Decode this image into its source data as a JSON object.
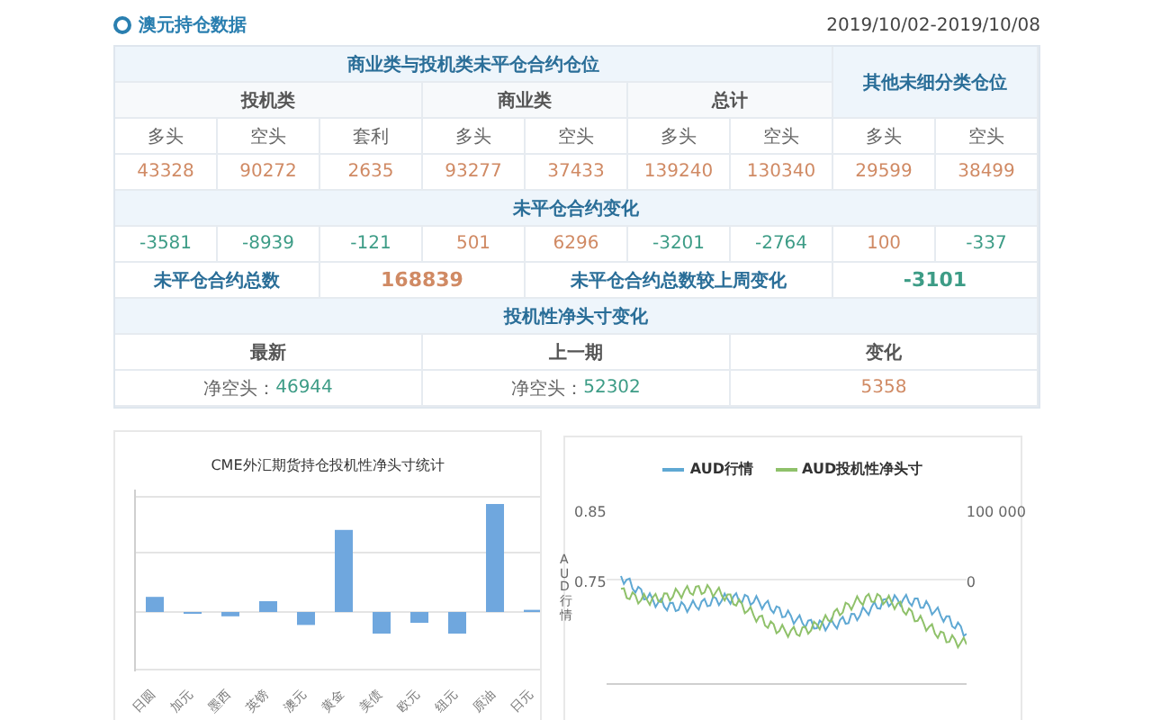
{
  "section": {
    "title": "澳元持仓数据",
    "date_range": "2019/10/02-2019/10/08"
  },
  "positions": {
    "title": "商业类与投机类未平仓合约仓位",
    "other_title": "其他未细分类仓位",
    "groups": [
      "投机类",
      "商业类",
      "总计"
    ],
    "columns": [
      "多头",
      "空头",
      "套利",
      "多头",
      "空头",
      "多头",
      "空头",
      "多头",
      "空头"
    ],
    "values": [
      "43328",
      "90272",
      "2635",
      "93277",
      "37433",
      "139240",
      "130340",
      "29599",
      "38499"
    ]
  },
  "changes": {
    "title": "未平仓合约变化",
    "values": [
      {
        "value": "-3581",
        "color": "#3d9c86"
      },
      {
        "value": "-8939",
        "color": "#3d9c86"
      },
      {
        "value": "-121",
        "color": "#3d9c86"
      },
      {
        "value": "501",
        "color": "#d08a64"
      },
      {
        "value": "6296",
        "color": "#d08a64"
      },
      {
        "value": "-3201",
        "color": "#3d9c86"
      },
      {
        "value": "-2764",
        "color": "#3d9c86"
      },
      {
        "value": "100",
        "color": "#d08a64"
      },
      {
        "value": "-337",
        "color": "#3d9c86"
      }
    ]
  },
  "totals": {
    "label": "未平仓合约总数",
    "value": "168839",
    "change_label": "未平仓合约总数较上周变化",
    "change_value": "-3101"
  },
  "net_position": {
    "title": "投机性净头寸变化",
    "columns": [
      "最新",
      "上一期",
      "变化"
    ],
    "latest_label": "净空头：",
    "latest": "46944",
    "previous_label": "净空头：",
    "previous": "52302",
    "change": "5358"
  },
  "bar_chart": {
    "title": "CME外汇期货持仓投机性净头寸统计",
    "categories": [
      "日圆",
      "加元",
      "墨西",
      "英镑",
      "澳元",
      "黄金",
      "美债",
      "欧元",
      "纽元",
      "原油",
      "日元"
    ]
  },
  "line_chart": {
    "legend": [
      {
        "name": "AUD行情",
        "color": "#5fa8d3"
      },
      {
        "name": "AUD投机性净头寸",
        "color": "#8fc16a"
      }
    ],
    "y_axis_label": "AUD行情",
    "left_ticks": [
      "0.85",
      "0.75"
    ],
    "right_ticks": [
      "100 000",
      "0"
    ]
  }
}
